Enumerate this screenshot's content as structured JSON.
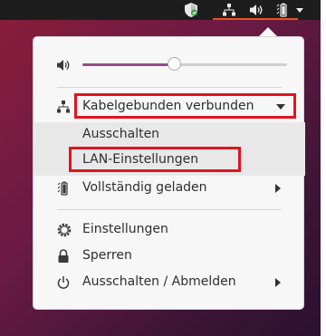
{
  "menu": {
    "volume_level": 0.45,
    "network_status": "Kabelgebunden verbunden",
    "network_items": [
      "Ausschalten",
      "LAN-Einstellungen"
    ],
    "battery_status": "Vollständig geladen",
    "settings": "Einstellungen",
    "lock": "Sperren",
    "power": "Ausschalten / Abmelden"
  },
  "colors": {
    "highlight": "#e0141e",
    "slider_fill": "#924d8b",
    "panel_accent": "#e95420",
    "shield_green": "#3ea04b"
  },
  "icons": [
    "shield-icon",
    "network-icon",
    "volume-icon",
    "battery-icon",
    "chevron-down-icon",
    "settings-icon",
    "lock-icon",
    "power-icon"
  ]
}
